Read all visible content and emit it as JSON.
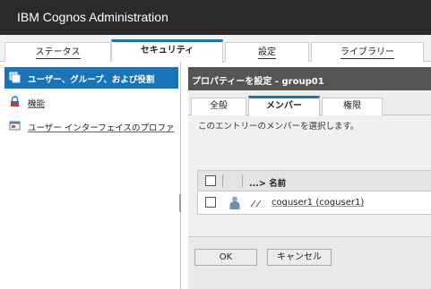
{
  "app": {
    "title": "IBM Cognos Administration"
  },
  "top_tabs": [
    {
      "label": "ステータス",
      "active": false
    },
    {
      "label": "セキュリティ",
      "active": true
    },
    {
      "label": "設定",
      "active": false
    },
    {
      "label": "ライブラリー",
      "active": false
    }
  ],
  "sidebar": {
    "items": [
      {
        "label": "ユーザー、グループ、および役割",
        "icon": "users-groups-icon",
        "selected": true
      },
      {
        "label": "機能",
        "icon": "lock-icon",
        "selected": false
      },
      {
        "label": "ユーザー インターフェイスのプロファ",
        "icon": "ui-profile-icon",
        "selected": false
      }
    ]
  },
  "properties": {
    "title": "プロパティーを設定 - group01",
    "tabs": [
      {
        "label": "全般",
        "active": false
      },
      {
        "label": "メンバー",
        "active": true
      },
      {
        "label": "権限",
        "active": false
      }
    ],
    "instructions": "このエントリーのメンバーを選択します。",
    "list": {
      "header_label": "...> 名前",
      "rows": [
        {
          "name": "coguser1 (coguser1)",
          "icon": "user-icon",
          "path_icon": "path-icon"
        }
      ]
    },
    "buttons": {
      "ok": "OK",
      "cancel": "キャンセル"
    }
  },
  "colors": {
    "accent": "#1a74b8",
    "header_bg": "#2a2a2a",
    "panel_header_bg": "#555555"
  }
}
